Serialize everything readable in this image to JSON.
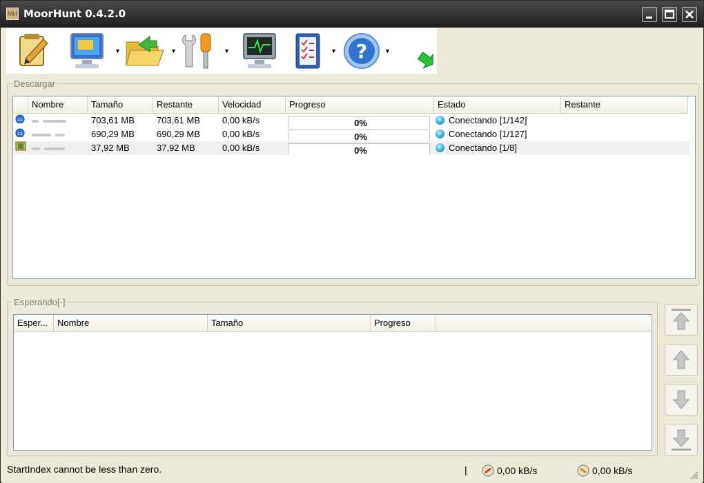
{
  "window": {
    "title": "MoorHunt 0.4.2.0",
    "icon_text": "MH"
  },
  "toolbar": {
    "items": [
      {
        "name": "notepad-pencil-icon"
      },
      {
        "name": "computer-monitor-icon",
        "has_dropdown": true
      },
      {
        "name": "open-folder-icon",
        "has_dropdown": true
      },
      {
        "name": "tools-wrench-screwdriver-icon",
        "has_dropdown": true
      },
      {
        "name": "activity-monitor-icon"
      },
      {
        "name": "checklist-icon",
        "has_dropdown": true
      },
      {
        "name": "help-question-icon",
        "has_dropdown": true
      },
      {
        "name": "green-arrow-icon"
      }
    ]
  },
  "downloads": {
    "group_label": "Descargar",
    "columns": [
      "Nombre",
      "Tamaño",
      "Restante",
      "Velocidad",
      "Progreso",
      "Estado",
      "Restante"
    ],
    "rows": [
      {
        "size": "703,61 MB",
        "remaining": "703,61 MB",
        "speed": "0,00 kB/s",
        "progress": "0%",
        "progress_value": 0,
        "status": "Conectando [1/142]"
      },
      {
        "size": "690,29 MB",
        "remaining": "690,29 MB",
        "speed": "0,00 kB/s",
        "progress": "0%",
        "progress_value": 0,
        "status": "Conectando [1/127]"
      },
      {
        "size": "37,92 MB",
        "remaining": "37,92 MB",
        "speed": "0,00 kB/s",
        "progress": "0%",
        "progress_value": 0,
        "status": "Conectando [1/8]"
      }
    ]
  },
  "waiting": {
    "group_label": "Esperando[-]",
    "columns": [
      "Esper...",
      "Nombre",
      "Tamaño",
      "Progreso"
    ]
  },
  "side_buttons": [
    "move-top-icon",
    "move-up-icon",
    "move-down-icon",
    "move-bottom-icon"
  ],
  "status": {
    "message": "StartIndex cannot be less than zero.",
    "separator": "|",
    "download_speed": "0,00 kB/s",
    "upload_speed": "0,00 kB/s"
  },
  "colors": {
    "titlebar": "#2b2b2b",
    "window_bg": "#ece9d8",
    "list_border": "#7f9db9",
    "status_globe": "#2ea8d1"
  }
}
